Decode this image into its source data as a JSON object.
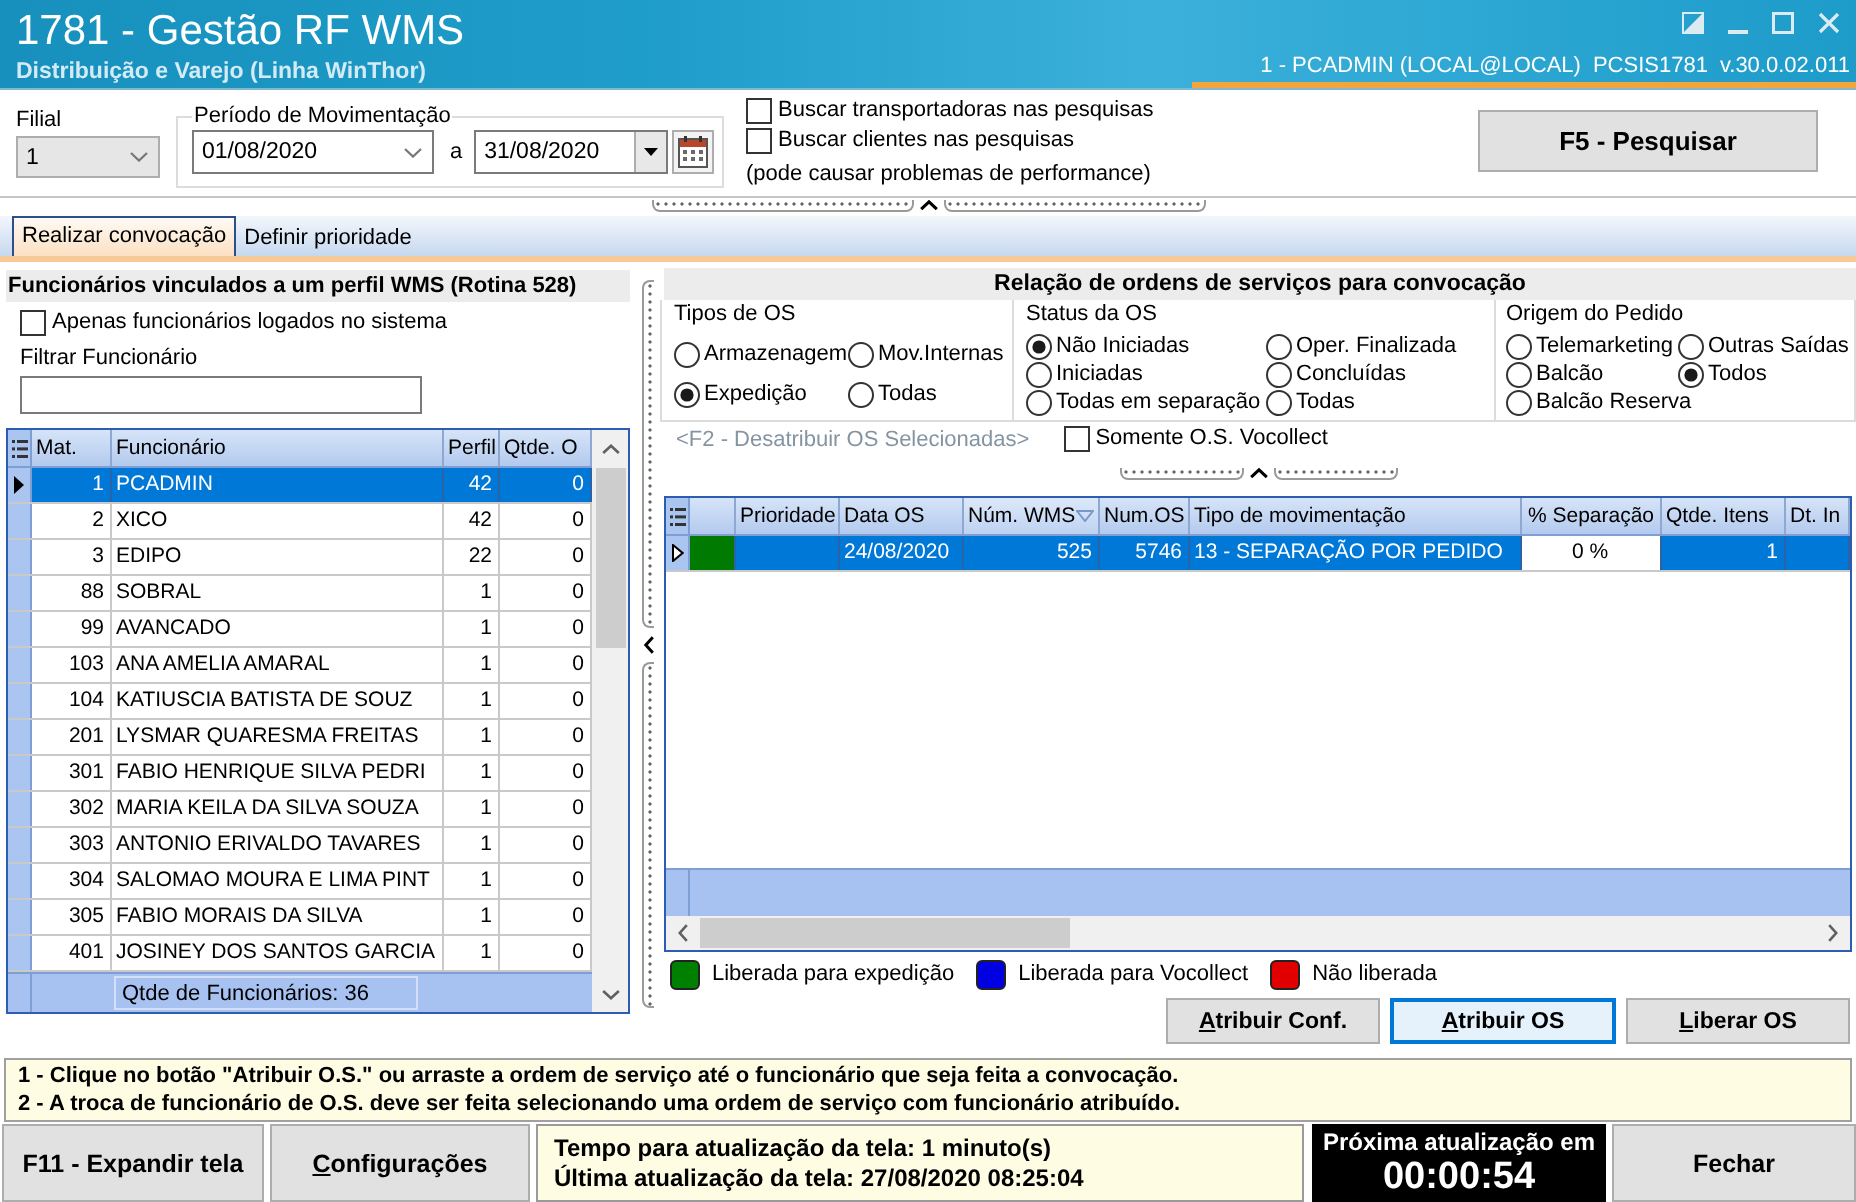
{
  "window": {
    "title": "1781 - Gestão RF WMS",
    "subtitle": "Distribuição e Varejo (Linha WinThor)",
    "user": "1 - PCADMIN (LOCAL@LOCAL)",
    "program": "PCSIS1781",
    "version": "v.30.0.02.011"
  },
  "filters": {
    "branch": {
      "label": "Filial",
      "value": "1"
    },
    "period": {
      "label": "Período de Movimentação",
      "from": "01/08/2020",
      "separator": "a",
      "to": "31/08/2020"
    },
    "options": [
      {
        "label": "Buscar transportadoras nas pesquisas",
        "checked": false
      },
      {
        "label": "Buscar clientes nas pesquisas",
        "checked": false
      }
    ],
    "options_note": "(pode causar problemas de performance)",
    "search_button": "F5 - Pesquisar"
  },
  "tabs": [
    {
      "label": "Realizar convocação",
      "selected": true
    },
    {
      "label": "Definir prioridade",
      "selected": false
    }
  ],
  "employees": {
    "title": "Funcionários vinculados a um perfil WMS (Rotina 528)",
    "logged_only": {
      "label": "Apenas funcionários logados no sistema",
      "checked": false
    },
    "filter_label": "Filtrar Funcionário",
    "columns": [
      "Mat.",
      "Funcionário",
      "Perfil",
      "Qtde. O"
    ],
    "rows": [
      {
        "mat": "1",
        "name": "PCADMIN",
        "profile": "42",
        "count": "0",
        "selected": true
      },
      {
        "mat": "2",
        "name": "XICO",
        "profile": "42",
        "count": "0",
        "selected": false
      },
      {
        "mat": "3",
        "name": "EDIPO",
        "profile": "22",
        "count": "0",
        "selected": false
      },
      {
        "mat": "88",
        "name": "SOBRAL",
        "profile": "1",
        "count": "0",
        "selected": false
      },
      {
        "mat": "99",
        "name": "AVANCADO",
        "profile": "1",
        "count": "0",
        "selected": false
      },
      {
        "mat": "103",
        "name": "ANA AMELIA AMARAL",
        "profile": "1",
        "count": "0",
        "selected": false
      },
      {
        "mat": "104",
        "name": "KATIUSCIA BATISTA DE SOUZ",
        "profile": "1",
        "count": "0",
        "selected": false
      },
      {
        "mat": "201",
        "name": "LYSMAR QUARESMA FREITAS",
        "profile": "1",
        "count": "0",
        "selected": false
      },
      {
        "mat": "301",
        "name": "FABIO HENRIQUE SILVA PEDRI",
        "profile": "1",
        "count": "0",
        "selected": false
      },
      {
        "mat": "302",
        "name": "MARIA KEILA DA SILVA SOUZA",
        "profile": "1",
        "count": "0",
        "selected": false
      },
      {
        "mat": "303",
        "name": "ANTONIO ERIVALDO TAVARES",
        "profile": "1",
        "count": "0",
        "selected": false
      },
      {
        "mat": "304",
        "name": "SALOMAO MOURA E LIMA PINT",
        "profile": "1",
        "count": "0",
        "selected": false
      },
      {
        "mat": "305",
        "name": "FABIO MORAIS DA SILVA",
        "profile": "1",
        "count": "0",
        "selected": false
      },
      {
        "mat": "401",
        "name": "JOSINEY DOS SANTOS GARCIA",
        "profile": "1",
        "count": "0",
        "selected": false
      }
    ],
    "footer": "Qtde de Funcionários: 36"
  },
  "orders": {
    "title": "Relação de ordens de serviços para convocação",
    "groups": [
      {
        "title": "Tipos de OS",
        "options": [
          {
            "label": "Armazenagem",
            "selected": false
          },
          {
            "label": "Mov.Internas",
            "selected": false
          },
          {
            "label": "Expedição",
            "selected": true
          },
          {
            "label": "Todas",
            "selected": false
          }
        ]
      },
      {
        "title": "Status da OS",
        "options": [
          {
            "label": "Não Iniciadas",
            "selected": true
          },
          {
            "label": "Oper. Finalizada",
            "selected": false
          },
          {
            "label": "Iniciadas",
            "selected": false
          },
          {
            "label": "Concluídas",
            "selected": false
          },
          {
            "label": "Todas em separação",
            "selected": false
          },
          {
            "label": "Todas",
            "selected": false
          }
        ]
      },
      {
        "title": "Origem do Pedido",
        "options": [
          {
            "label": "Telemarketing",
            "selected": false
          },
          {
            "label": "Outras Saídas",
            "selected": false
          },
          {
            "label": "Balcão",
            "selected": false
          },
          {
            "label": "Todos",
            "selected": true
          },
          {
            "label": "Balcão Reserva",
            "selected": false
          }
        ]
      }
    ],
    "unassign_action": {
      "label": "<F2 - Desatribuir OS Selecionadas>",
      "disabled": true
    },
    "vocollect_only": {
      "label": "Somente O.S. Vocollect",
      "checked": false
    },
    "table": {
      "columns": [
        {
          "label": "Prioridade",
          "sorted": false
        },
        {
          "label": "Data OS",
          "sorted": false
        },
        {
          "label": "Núm. WMS",
          "sorted": true
        },
        {
          "label": "Num.OS",
          "sorted": false
        },
        {
          "label": "Tipo de movimentação",
          "sorted": false
        },
        {
          "label": "% Separação",
          "sorted": false
        },
        {
          "label": "Qtde. Itens",
          "sorted": false
        },
        {
          "label": "Dt. In",
          "sorted": false
        }
      ],
      "rows": [
        {
          "selected": true,
          "color": "#007a00",
          "date": "24/08/2020",
          "wms": "525",
          "os": "5746",
          "type": "13 - SEPARAÇÃO POR PEDIDO",
          "separation": "0 %",
          "items": "1"
        }
      ]
    },
    "legend": [
      {
        "label": "Liberada para expedição",
        "color": "#008000"
      },
      {
        "label": "Liberada para Vocollect",
        "color": "#0000e0"
      },
      {
        "label": "Não liberada",
        "color": "#e00000"
      }
    ],
    "buttons": [
      {
        "label": "Atribuir Conf.",
        "mnemonic": true,
        "focused": false
      },
      {
        "label": "Atribuir OS",
        "mnemonic": true,
        "focused": true
      },
      {
        "label": "Liberar OS",
        "mnemonic": true,
        "focused": false
      }
    ]
  },
  "instructions": [
    "1 - Clique no botão \"Atribuir O.S.\" ou arraste a ordem de serviço até o funcionário que seja feita a convocação.",
    "2 - A troca de funcionário de O.S. deve ser feita selecionando uma ordem de serviço com funcionário atribuído."
  ],
  "footer": {
    "expand_button": "F11 - Expandir tela",
    "settings_button": {
      "label": "Configurações",
      "mnemonic": true
    },
    "refresh_interval": "Tempo para atualização da tela: 1 minuto(s)",
    "last_update": "Última atualização da tela: 27/08/2020 08:25:04",
    "countdown_label": "Próxima atualização em",
    "countdown": "00:00:54",
    "close_button": "Fechar"
  }
}
